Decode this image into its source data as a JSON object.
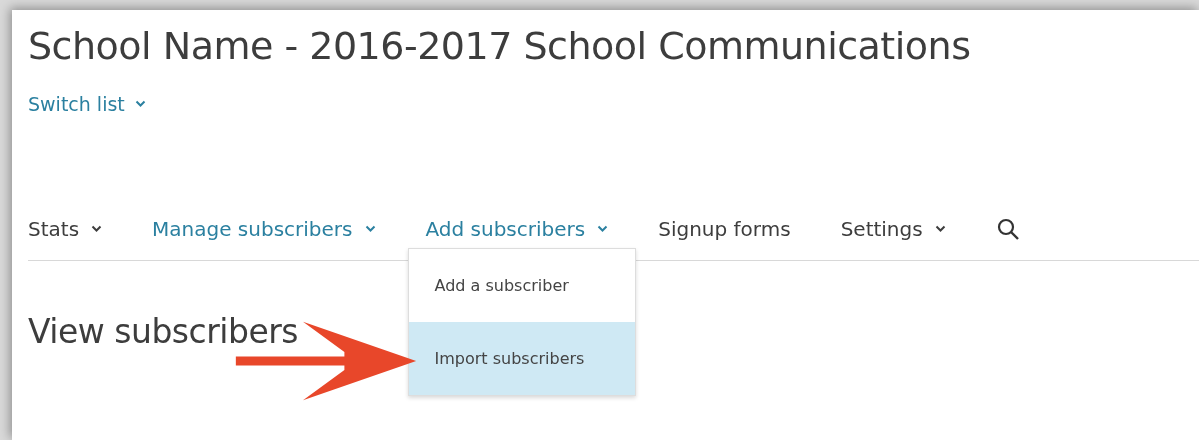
{
  "header": {
    "title": "School Name - 2016-2017 School Communications",
    "switch_list": "Switch list"
  },
  "nav": [
    {
      "label": "Stats",
      "highlighted": false,
      "dropdown": true
    },
    {
      "label": "Manage subscribers",
      "highlighted": true,
      "dropdown": true
    },
    {
      "label": "Add subscribers",
      "highlighted": true,
      "dropdown": true,
      "menu": [
        {
          "label": "Add a subscriber",
          "selected": false
        },
        {
          "label": "Import subscribers",
          "selected": true
        }
      ]
    },
    {
      "label": "Signup forms",
      "highlighted": false,
      "dropdown": false
    },
    {
      "label": "Settings",
      "highlighted": false,
      "dropdown": true
    }
  ],
  "section_title": "View subscribers"
}
